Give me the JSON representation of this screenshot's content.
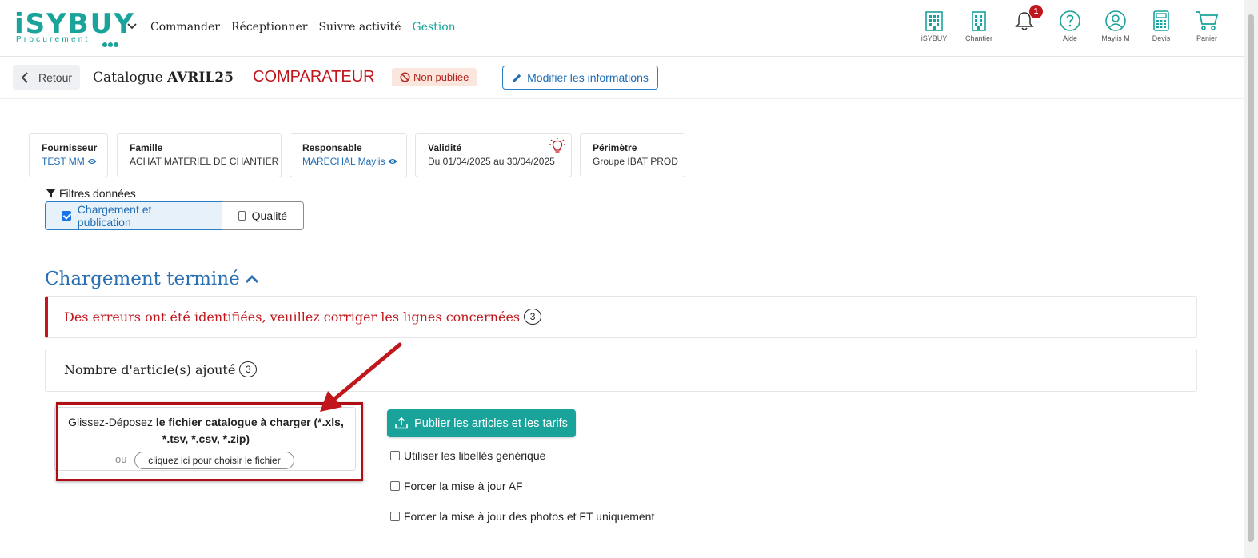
{
  "header": {
    "logo_text": "iSYBUY",
    "logo_subtext": "Procurement",
    "nav": [
      "Commander",
      "Réceptionner",
      "Suivre activité",
      "Gestion"
    ],
    "active_nav": "Gestion",
    "tools": [
      {
        "label": "iSYBUY",
        "icon": "building-icon"
      },
      {
        "label": "Chantier",
        "icon": "building-icon"
      },
      {
        "label": "",
        "icon": "bell-icon",
        "badge": "1"
      },
      {
        "label": "Aide",
        "icon": "help-circle-icon"
      },
      {
        "label": "Maylis M",
        "icon": "user-circle-icon"
      },
      {
        "label": "Devis",
        "icon": "calculator-icon"
      },
      {
        "label": "Panier",
        "icon": "cart-icon"
      }
    ],
    "accent_color": "#1aa39b"
  },
  "subheader": {
    "back_label": "Retour",
    "catalog_prefix": "Catalogue",
    "catalog_name": "AVRIL25",
    "mode": "COMPARATEUR",
    "status": "Non publiée",
    "edit_label": "Modifier les informations"
  },
  "info_cards": {
    "supplier": {
      "title": "Fournisseur",
      "value": "TEST MM"
    },
    "family": {
      "title": "Famille",
      "value": "ACHAT MATERIEL DE CHANTIER"
    },
    "manager": {
      "title": "Responsable",
      "value": "MARECHAL Maylis"
    },
    "validity": {
      "title": "Validité",
      "value": "Du 01/04/2025 au 30/04/2025"
    },
    "scope": {
      "title": "Périmètre",
      "value": "Groupe IBAT PROD"
    }
  },
  "filters": {
    "label": "Filtres données",
    "options": [
      {
        "label": "Chargement et publication",
        "checked": true
      },
      {
        "label": "Qualité",
        "checked": false
      }
    ]
  },
  "section": {
    "title": "Chargement terminé",
    "error_message": "Des erreurs ont été identifiées, veuillez corriger les lignes concernées",
    "error_count": "3",
    "added_label": "Nombre d'article(s) ajouté",
    "added_count": "3"
  },
  "dropzone": {
    "text_plain": "Glissez-Déposez ",
    "text_bold": "le fichier catalogue à charger (*.xls, *.tsv, *.csv, *.zip)",
    "or_label": "ou",
    "choose_label": "cliquez ici pour choisir le fichier"
  },
  "publish": {
    "button_label": "Publier les articles et les tarifs",
    "options": [
      {
        "label": "Utiliser les libellés générique",
        "checked": false
      },
      {
        "label": "Forcer la mise à jour AF",
        "checked": false
      },
      {
        "label": "Forcer la mise à jour des photos et FT uniquement",
        "checked": false
      }
    ]
  }
}
